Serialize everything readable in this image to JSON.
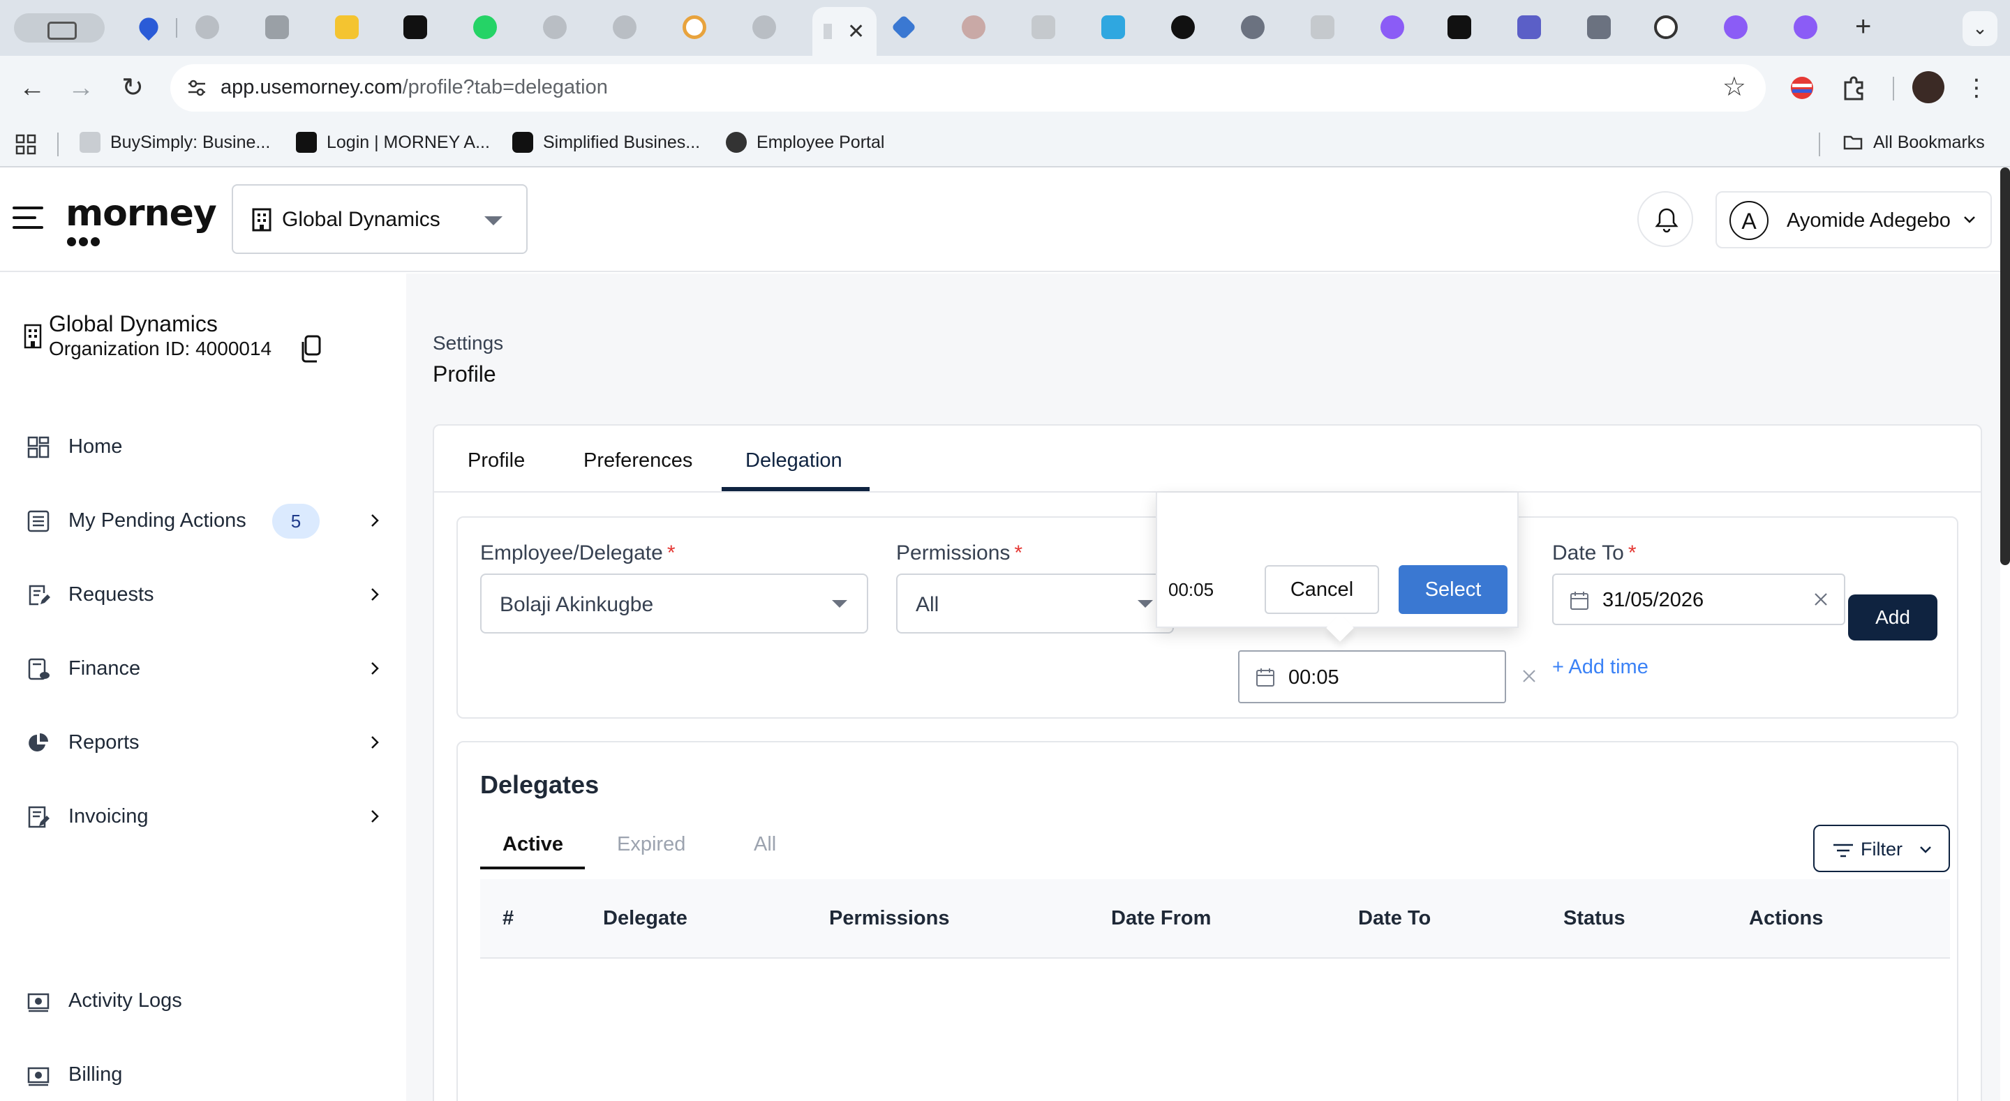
{
  "browser": {
    "url_host": "app.usemorney.com",
    "url_path": "/profile?tab=delegation",
    "bookmarks": [
      {
        "label": "BuySimply: Busine..."
      },
      {
        "label": "Login | MORNEY A..."
      },
      {
        "label": "Simplified Busines..."
      },
      {
        "label": "Employee Portal"
      }
    ],
    "all_bookmarks_label": "All Bookmarks"
  },
  "header": {
    "logo": "morney",
    "org_selector": "Global Dynamics",
    "user_initial": "A",
    "user_name": "Ayomide Adegebo"
  },
  "sidebar": {
    "org_name": "Global Dynamics",
    "org_id": "Organization ID: 4000014",
    "items": [
      {
        "label": "Home"
      },
      {
        "label": "My Pending Actions",
        "badge": "5"
      },
      {
        "label": "Requests"
      },
      {
        "label": "Finance"
      },
      {
        "label": "Reports"
      },
      {
        "label": "Invoicing"
      },
      {
        "label": "Activity Logs"
      },
      {
        "label": "Billing"
      }
    ]
  },
  "main": {
    "breadcrumb": "Settings",
    "page_title": "Profile",
    "tabs": [
      {
        "label": "Profile"
      },
      {
        "label": "Preferences"
      },
      {
        "label": "Delegation",
        "active": true
      }
    ],
    "form": {
      "employee_label": "Employee/Delegate",
      "employee_value": "Bolaji Akinkugbe",
      "permissions_label": "Permissions",
      "permissions_value": "All",
      "date_to_label": "Date To",
      "date_to_value": "31/05/2026",
      "time_value": "00:05",
      "add_time_label": "+ Add time",
      "add_button": "Add",
      "required_mark": "*"
    },
    "time_popover": {
      "value": "00:05",
      "cancel_label": "Cancel",
      "select_label": "Select"
    },
    "delegates": {
      "title": "Delegates",
      "subtabs": [
        {
          "label": "Active",
          "active": true
        },
        {
          "label": "Expired"
        },
        {
          "label": "All"
        }
      ],
      "filter_label": "Filter",
      "columns": [
        "#",
        "Delegate",
        "Permissions",
        "Date From",
        "Date To",
        "Status",
        "Actions"
      ]
    }
  },
  "colors": {
    "primary_dark": "#0f2340",
    "select_blue": "#3a78d2",
    "link_blue": "#3b82f6",
    "required_red": "#e53935",
    "badge_bg": "#dbeafe"
  }
}
